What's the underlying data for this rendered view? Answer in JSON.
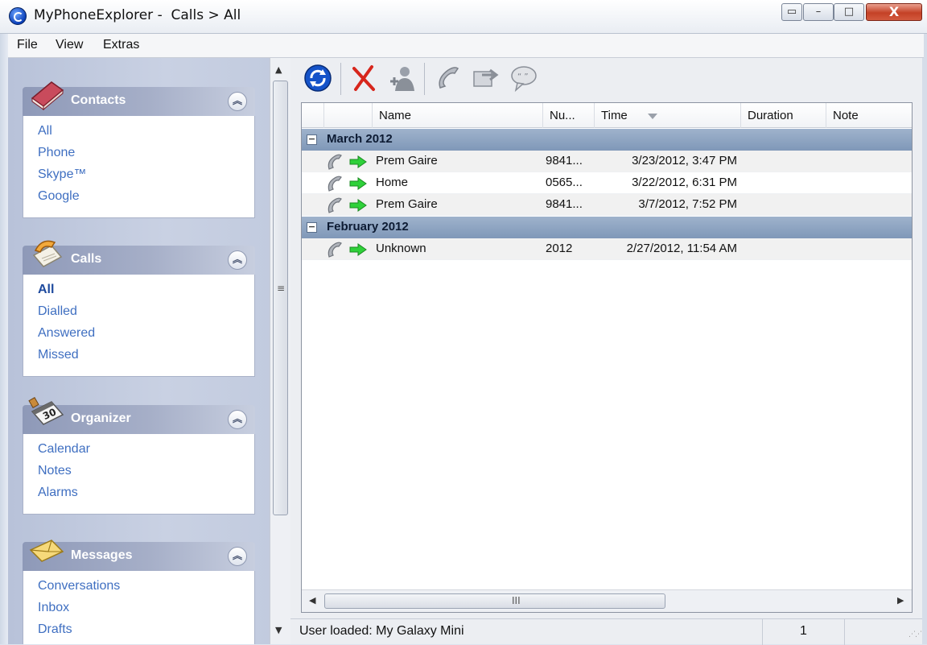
{
  "window": {
    "title": "MyPhoneExplorer -  Calls > All",
    "minimize_glyph": "–",
    "maximize_glyph": "□",
    "close_glyph": "X"
  },
  "menu": {
    "items": [
      "File",
      "View",
      "Extras"
    ]
  },
  "sidebar": {
    "panels": [
      {
        "title": "Contacts",
        "icon": "contacts-book-icon",
        "collapse_glyph": "⌃",
        "items": [
          "All",
          "Phone",
          "Skype™",
          "Google"
        ],
        "active": null
      },
      {
        "title": "Calls",
        "icon": "calls-phone-icon",
        "collapse_glyph": "⌃",
        "items": [
          "All",
          "Dialled",
          "Answered",
          "Missed"
        ],
        "active": 0
      },
      {
        "title": "Organizer",
        "icon": "organizer-calendar-icon",
        "collapse_glyph": "⌃",
        "items": [
          "Calendar",
          "Notes",
          "Alarms"
        ],
        "active": null
      },
      {
        "title": "Messages",
        "icon": "messages-envelope-icon",
        "collapse_glyph": "⌃",
        "items": [
          "Conversations",
          "Inbox",
          "Drafts"
        ],
        "active": null
      }
    ],
    "scroll_up_glyph": "▲",
    "scroll_down_glyph": "▼",
    "scroll_grip_glyph": "≡"
  },
  "toolbar": {
    "buttons": [
      {
        "name": "refresh",
        "icon": "refresh-icon"
      },
      {
        "name": "delete",
        "icon": "delete-icon"
      },
      {
        "name": "add-contact",
        "icon": "add-contact-icon"
      },
      {
        "name": "call",
        "icon": "phone-icon"
      },
      {
        "name": "forward",
        "icon": "forward-icon"
      },
      {
        "name": "message",
        "icon": "speech-bubble-icon"
      }
    ]
  },
  "grid": {
    "columns": [
      "Name",
      "Nu...",
      "Time",
      "Duration",
      "Note"
    ],
    "sorted_column": "Time",
    "groups": [
      {
        "label": "March 2012",
        "toggle": "−",
        "rows": [
          {
            "name": "Prem Gaire",
            "number": "9841...",
            "time": "3/23/2012, 3:47 PM",
            "duration": "",
            "note": ""
          },
          {
            "name": "Home",
            "number": "0565...",
            "time": "3/22/2012, 6:31 PM",
            "duration": "",
            "note": ""
          },
          {
            "name": "Prem Gaire",
            "number": "9841...",
            "time": "3/7/2012, 7:52 PM",
            "duration": "",
            "note": ""
          }
        ]
      },
      {
        "label": "February 2012",
        "toggle": "−",
        "rows": [
          {
            "name": "Unknown",
            "number": "2012",
            "time": "2/27/2012, 11:54 AM",
            "duration": "",
            "note": ""
          }
        ]
      }
    ],
    "hscroll_left_glyph": "◀",
    "hscroll_right_glyph": "▶",
    "hscroll_grip_glyph": "III"
  },
  "status": {
    "text": "User loaded: My Galaxy Mini",
    "count": "1"
  },
  "colors": {
    "link": "#3f6fc1",
    "group_header": "#8aa0bf",
    "sidebar_bg": "#c2cbdf"
  }
}
